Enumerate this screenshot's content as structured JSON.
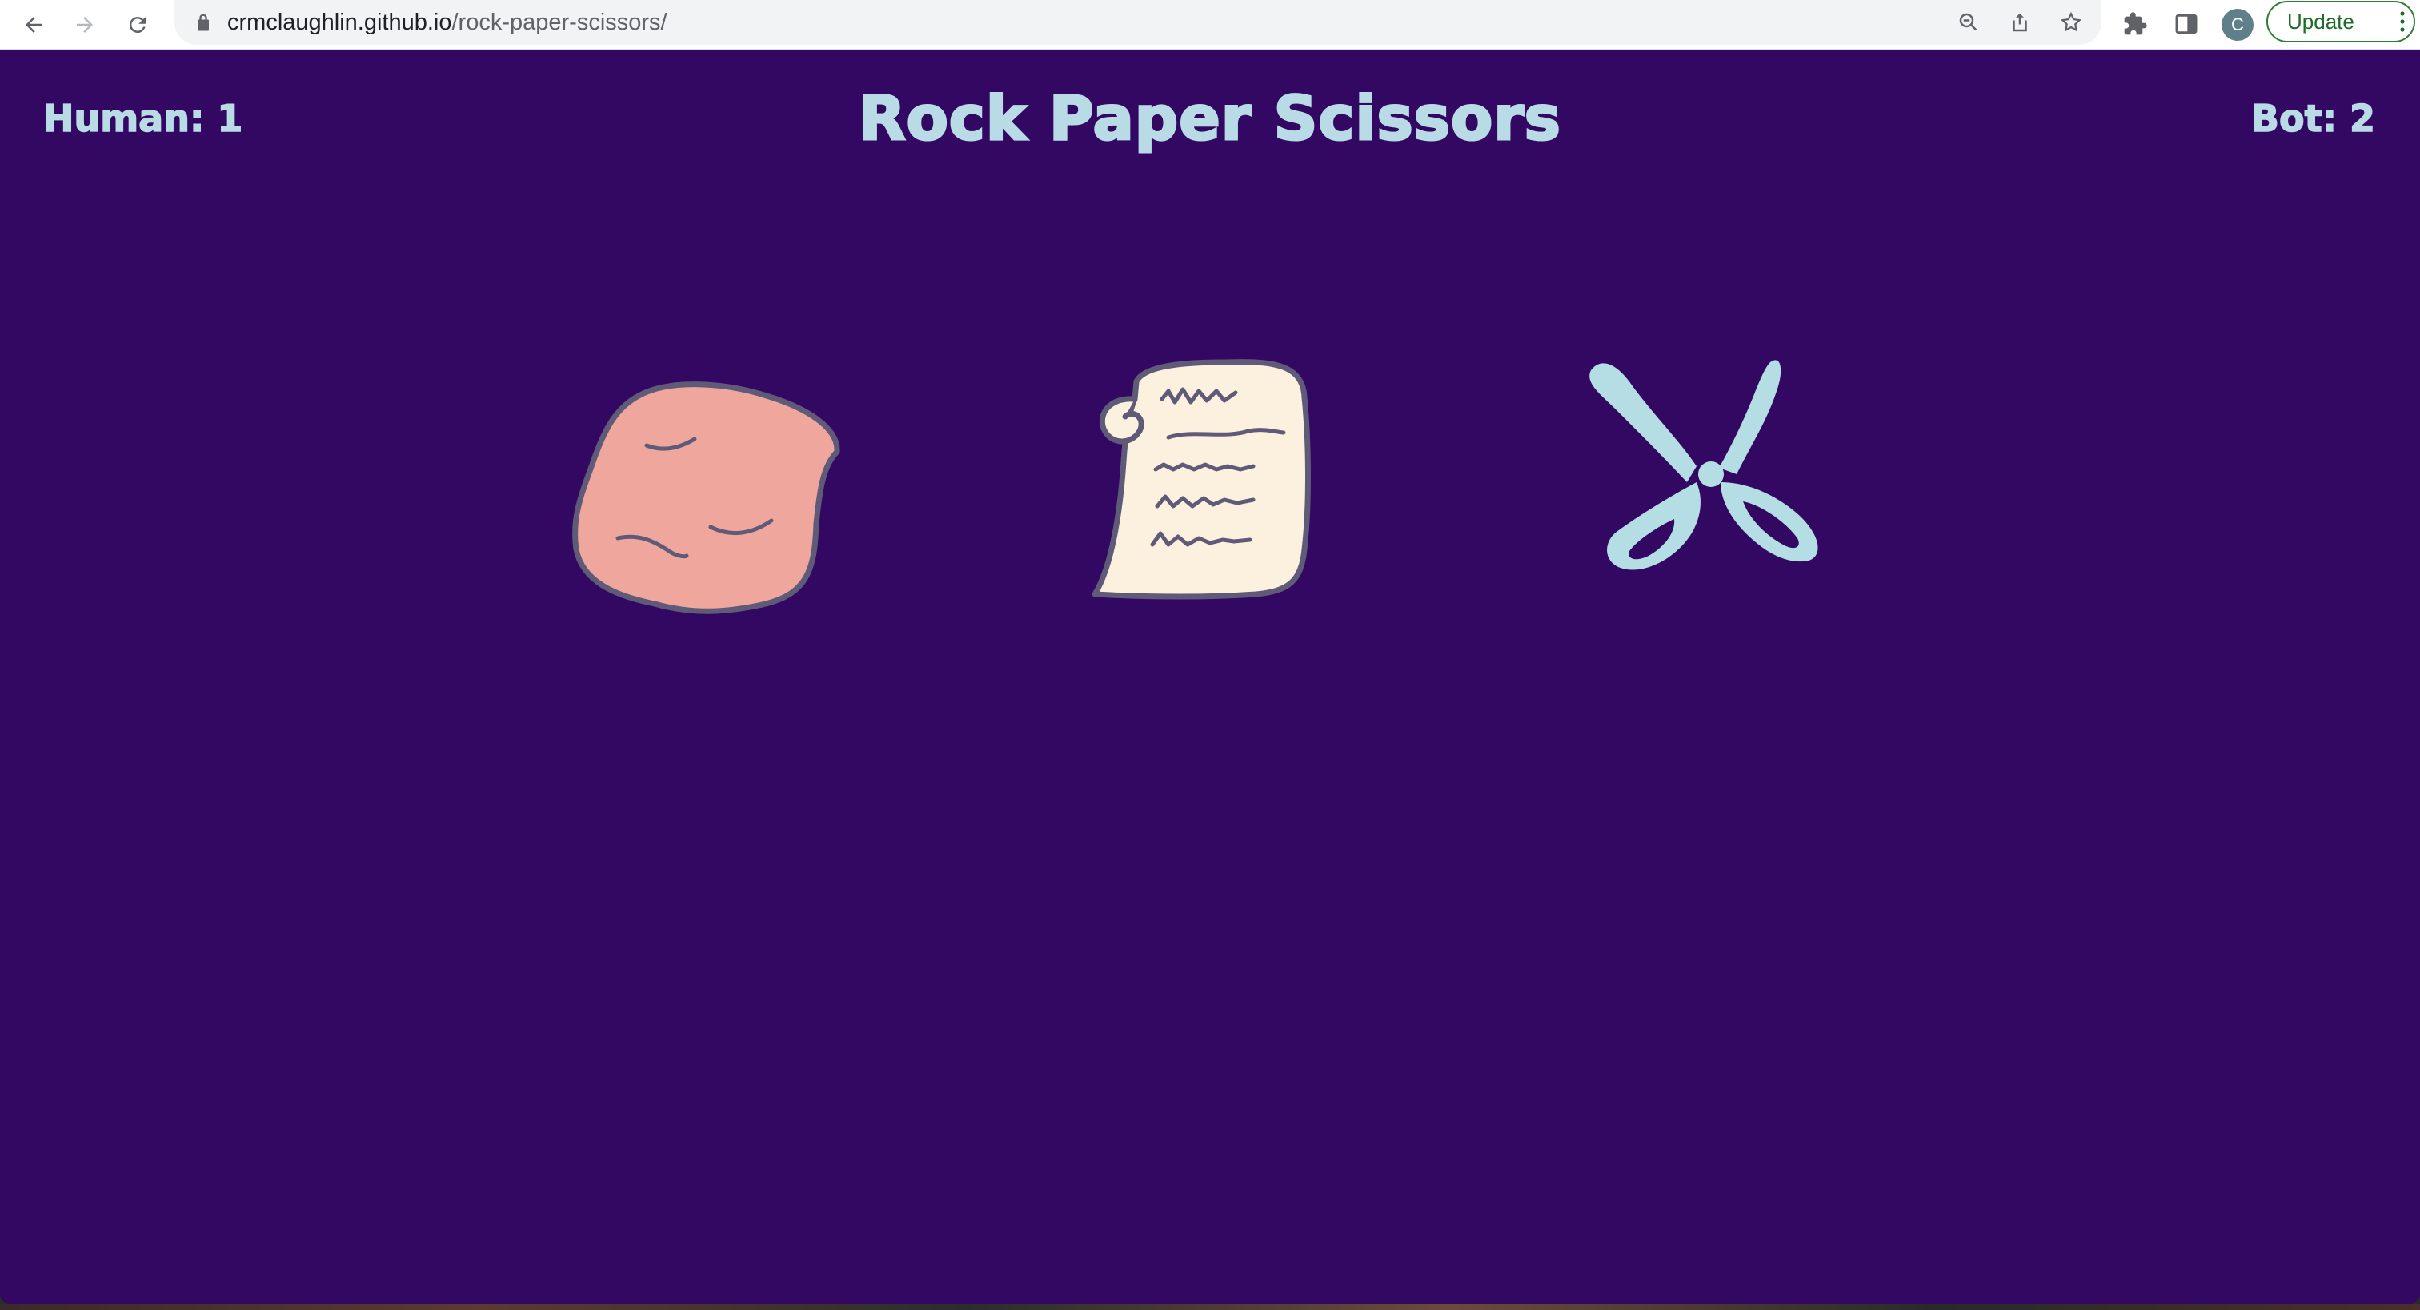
{
  "browser": {
    "url_host": "crmclaughlin.github.io",
    "url_path": "/rock-paper-scissors/",
    "avatar_initial": "C",
    "update_label": "Update",
    "icons": [
      "back-icon",
      "forward-icon",
      "reload-icon",
      "lock-icon",
      "zoom-icon",
      "share-icon",
      "star-icon",
      "extensions-icon",
      "side-panel-icon",
      "menu-icon"
    ]
  },
  "game": {
    "title": "Rock Paper Scissors",
    "human_score": "Human: 1",
    "bot_score": "Bot: 2",
    "choices": [
      "rock",
      "paper",
      "scissors"
    ]
  },
  "colors": {
    "background": "#330862",
    "text": "#b9dbe6",
    "rock": "#efa69c",
    "paper": "#fbf1de",
    "scissors": "#b5dde4",
    "outline": "#5e5a78"
  }
}
